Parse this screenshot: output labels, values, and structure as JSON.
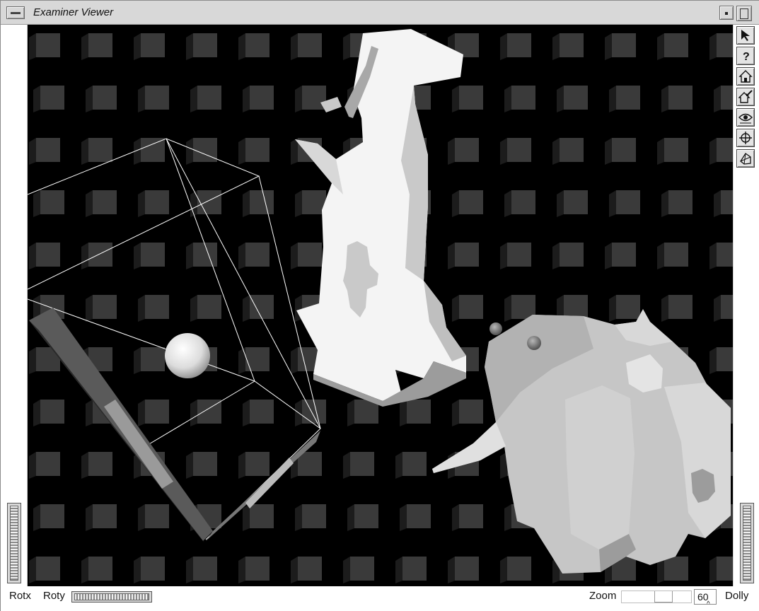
{
  "window": {
    "title": "Examiner Viewer"
  },
  "toolbar": [
    {
      "id": "pick",
      "icon": "arrow-pointer-icon"
    },
    {
      "id": "help",
      "icon": "question-mark-icon",
      "label": "?"
    },
    {
      "id": "home",
      "icon": "home-icon"
    },
    {
      "id": "set-home",
      "icon": "set-home-icon"
    },
    {
      "id": "view-all",
      "icon": "eye-icon"
    },
    {
      "id": "seek",
      "icon": "crosshair-icon"
    },
    {
      "id": "projection",
      "icon": "perspective-cube-icon"
    }
  ],
  "bottom": {
    "rotx_label": "Rotx",
    "roty_label": "Roty",
    "zoom_label": "Zoom",
    "zoom_value": "60",
    "dolly_label": "Dolly"
  },
  "scene": {
    "background": "#000000",
    "cube_color": "#3a3a3a",
    "object_color": "#ffffff"
  }
}
